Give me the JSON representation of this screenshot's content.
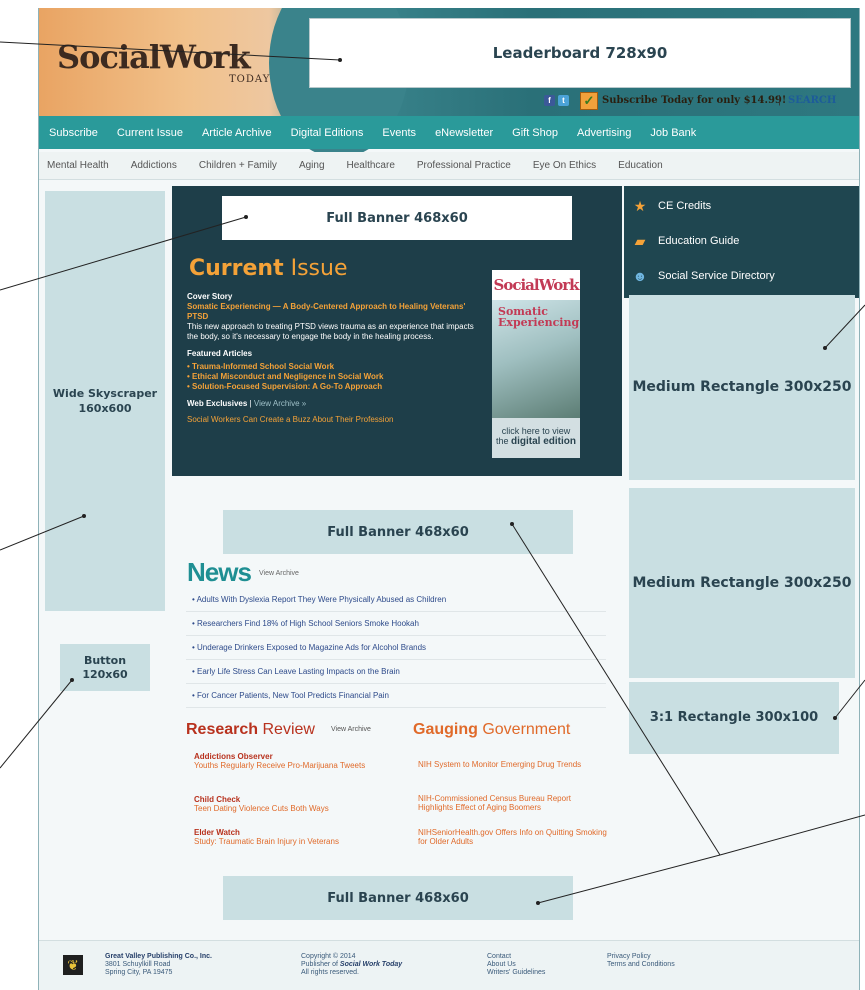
{
  "header": {
    "logo_main": "SocialWork",
    "logo_sub": "TODAY",
    "leaderboard_label": "Leaderboard 728x90",
    "subscribe_text": "Subscribe Today for only $14.99!",
    "search_sep": "|",
    "search_label": "SEARCH",
    "social_icons": [
      "facebook-icon",
      "twitter-icon"
    ]
  },
  "main_nav": [
    "Subscribe",
    "Current Issue",
    "Article Archive",
    "Digital Editions",
    "Events",
    "eNewsletter",
    "Gift Shop",
    "Advertising",
    "Job Bank"
  ],
  "sub_nav": [
    "Mental Health",
    "Addictions",
    "Children + Family",
    "Aging",
    "Healthcare",
    "Professional Practice",
    "Eye On Ethics",
    "Education"
  ],
  "left": {
    "skyscraper": "Wide Skyscraper 160x600",
    "button_ad": "Button 120x60"
  },
  "current_issue": {
    "banner": "Full Banner 468x60",
    "title_bold": "Current",
    "title_rest": " Issue",
    "cover_story_label": "Cover Story",
    "cover_story_title": "Somatic Experiencing — A Body-Centered Approach to Healing Veterans' PTSD",
    "cover_story_desc": "This new approach to treating PTSD views trauma as an experience that impacts the body, so it's necessary to engage the body in the healing process.",
    "featured_label": "Featured Articles",
    "featured": [
      "• Trauma-Informed School Social Work",
      "• Ethical Misconduct and Negligence in Social Work",
      "• Solution-Focused Supervision: A Go-To Approach"
    ],
    "web_exclusives_label": "Web Exclusives",
    "web_sep": "|",
    "view_archive": "View Archive »",
    "web_exclusive_item": "Social Workers Can Create a Buzz About Their Profession",
    "cover_logo": "SocialWork",
    "cover_headline": "Somatic Experiencing",
    "cover_cta_1": "click here to view",
    "cover_cta_2a": "the ",
    "cover_cta_2b": "digital edition"
  },
  "right_panel": {
    "items": [
      "CE Credits",
      "Education Guide",
      "Social Service Directory"
    ],
    "medium_rect_1": "Medium Rectangle 300x250",
    "medium_rect_2": "Medium Rectangle 300x250",
    "rect_31": "3:1 Rectangle 300x100"
  },
  "center": {
    "banner_2": "Full Banner 468x60",
    "news_title": "News",
    "news_archive": "View Archive",
    "news_items": [
      "• Adults With Dyslexia Report They Were Physically Abused as Children",
      "• Researchers Find 18% of High School Seniors Smoke Hookah",
      "• Underage Drinkers Exposed to Magazine Ads for Alcohol Brands",
      "• Early Life Stress Can Leave Lasting Impacts on the Brain",
      "• For Cancer Patients, New Tool Predicts Financial Pain"
    ],
    "rr_title_bold": "Research",
    "rr_title_rest": " Review",
    "rr_archive": "View Archive",
    "rr_items": [
      {
        "head": "Addictions Observer",
        "body": "Youths Regularly Receive Pro-Marijuana Tweets"
      },
      {
        "head": "Child Check",
        "body": "Teen Dating Violence Cuts Both Ways"
      },
      {
        "head": "Elder Watch",
        "body": "Study: Traumatic Brain Injury in Veterans"
      }
    ],
    "gg_title_bold": "Gauging",
    "gg_title_rest": " Government",
    "gg_items": [
      "NIH System to Monitor Emerging Drug Trends",
      "NIH-Commissioned Census Bureau Report Highlights Effect of Aging Boomers",
      "NIHSeniorHealth.gov Offers Info on Quitting Smoking for Older Adults"
    ],
    "banner_3": "Full Banner 468x60"
  },
  "footer": {
    "company": "Great Valley Publishing Co., Inc.",
    "address_1": "3801 Schuylkill Road",
    "address_2": "Spring City, PA 19475",
    "copyright_1": "Copyright © 2014",
    "copyright_2a": "Publisher of ",
    "copyright_2b": "Social Work Today",
    "copyright_3": "All rights reserved.",
    "links_1": [
      "Contact",
      "About Us",
      "Writers' Guidelines"
    ],
    "links_2": [
      "Privacy Policy",
      "Terms and Conditions"
    ]
  }
}
